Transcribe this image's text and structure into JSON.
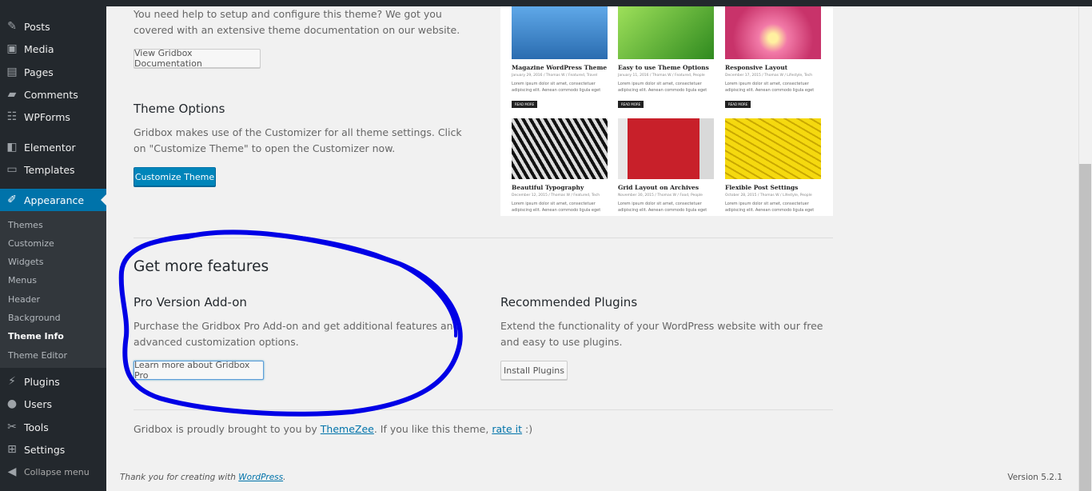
{
  "sidebar": {
    "items": [
      {
        "label": "Posts",
        "icon": "pin-icon"
      },
      {
        "label": "Media",
        "icon": "media-icon"
      },
      {
        "label": "Pages",
        "icon": "pages-icon"
      },
      {
        "label": "Comments",
        "icon": "comment-icon"
      },
      {
        "label": "WPForms",
        "icon": "forms-icon"
      },
      {
        "label": "Elementor",
        "icon": "elementor-icon"
      },
      {
        "label": "Templates",
        "icon": "folder-icon"
      },
      {
        "label": "Appearance",
        "icon": "brush-icon"
      },
      {
        "label": "Plugins",
        "icon": "plug-icon"
      },
      {
        "label": "Users",
        "icon": "user-icon"
      },
      {
        "label": "Tools",
        "icon": "wrench-icon"
      },
      {
        "label": "Settings",
        "icon": "settings-icon"
      },
      {
        "label": "Collapse menu",
        "icon": "collapse-icon"
      }
    ],
    "submenu": [
      "Themes",
      "Customize",
      "Widgets",
      "Menus",
      "Header",
      "Background",
      "Theme Info",
      "Theme Editor"
    ],
    "current_submenu": "Theme Info"
  },
  "docs": {
    "text": "You need help to setup and configure this theme? We got you covered with an extensive theme documentation on our website.",
    "button": "View Gridbox Documentation"
  },
  "options": {
    "title": "Theme Options",
    "text": "Gridbox makes use of the Customizer for all theme settings. Click on \"Customize Theme\" to open the Customizer now.",
    "button": "Customize Theme"
  },
  "preview": {
    "cards": [
      {
        "title": "Magazine WordPress Theme",
        "meta": "January 29, 2016 / Thomas W / Featured, Travel",
        "excerpt": "Lorem ipsum dolor sit amet, consectetuer adipiscing elit. Aenean commodo ligula eget",
        "more": "READ MORE",
        "image": "teddy-bear-image",
        "color": "#3d7fc1"
      },
      {
        "title": "Easy to use Theme Options",
        "meta": "January 11, 2016 / Thomas W / Featured, People",
        "excerpt": "Lorem ipsum dolor sit amet, consectetuer adipiscing elit. Aenean commodo ligula eget",
        "more": "READ MORE",
        "image": "green-leaf-image",
        "color": "#3fa02a"
      },
      {
        "title": "Responsive Layout",
        "meta": "December 17, 2015 / Thomas W / Lifestyle, Tech",
        "excerpt": "Lorem ipsum dolor sit amet, consectetuer adipiscing elit. Aenean commodo ligula eget",
        "more": "READ MORE",
        "image": "pink-flower-image",
        "color": "#e0508a"
      },
      {
        "title": "Beautiful Typography",
        "meta": "December 12, 2015 / Thomas W / Featured, Tech",
        "excerpt": "Lorem ipsum dolor sit amet, consectetuer adipiscing elit. Aenean commodo ligula eget",
        "more": "",
        "image": "zebras-image",
        "color": "#555555"
      },
      {
        "title": "Grid Layout on Archives",
        "meta": "November 30, 2015 / Thomas W / Food, People",
        "excerpt": "Lorem ipsum dolor sit amet, consectetuer adipiscing elit. Aenean commodo ligula eget",
        "more": "",
        "image": "telephone-box-image",
        "color": "#c8202a"
      },
      {
        "title": "Flexible Post Settings",
        "meta": "October 28, 2015 / Thomas W / Lifestyle, People",
        "excerpt": "Lorem ipsum dolor sit amet, consectetuer adipiscing elit. Aenean commodo ligula eget",
        "more": "",
        "image": "bananas-image",
        "color": "#e8c90a"
      }
    ]
  },
  "features": {
    "title": "Get more features",
    "pro": {
      "title": "Pro Version Add-on",
      "text": "Purchase the Gridbox Pro Add-on and get additional features and advanced customization options.",
      "button": "Learn more about Gridbox Pro"
    },
    "plugins": {
      "title": "Recommended Plugins",
      "text": "Extend the functionality of your WordPress website with our free and easy to use plugins.",
      "button": "Install Plugins"
    }
  },
  "credits": {
    "prefix": "Gridbox is proudly brought to you by ",
    "link1": "ThemeZee",
    "middle": ". If you like this theme, ",
    "link2": "rate it",
    "suffix": " :)"
  },
  "footer": {
    "thanks": "Thank you for creating with ",
    "link": "WordPress",
    "dot": ".",
    "version": "Version 5.2.1"
  },
  "colors": {
    "sidebar_bg": "#23282d",
    "accent": "#0073aa",
    "annotation": "#0000e6"
  }
}
